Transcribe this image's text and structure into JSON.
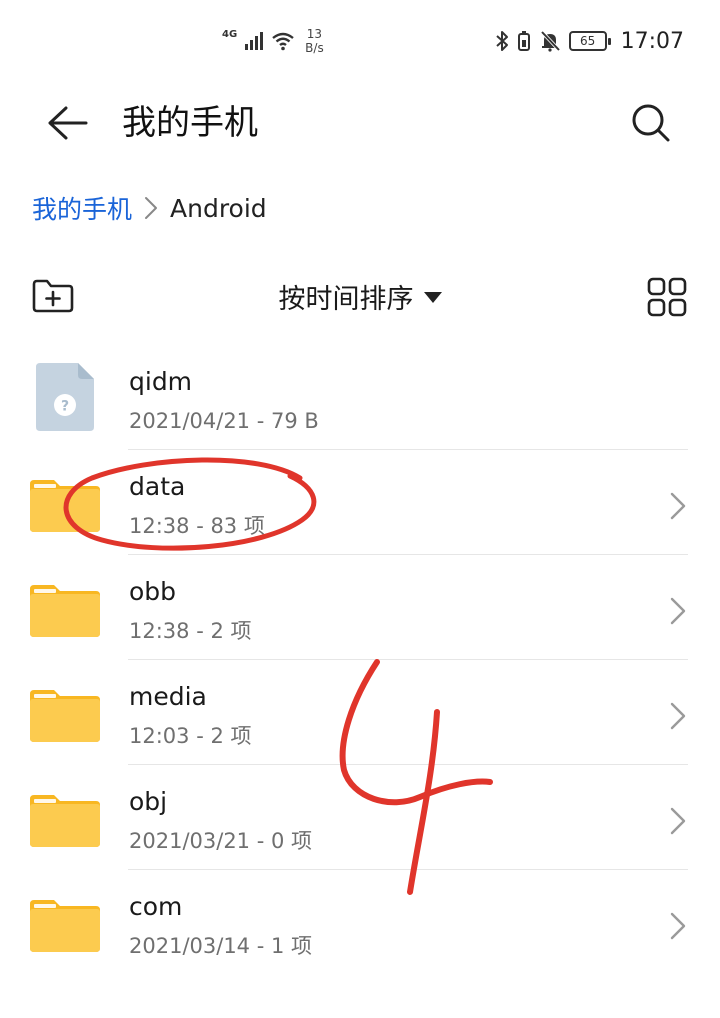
{
  "status_bar": {
    "network_type": "4G",
    "net_speed_value": "13",
    "net_speed_unit": "B/s",
    "battery_level": "65",
    "time": "17:07"
  },
  "header": {
    "title": "我的手机",
    "back_icon": "arrow-left-icon",
    "search_icon": "search-icon"
  },
  "breadcrumb": {
    "root": "我的手机",
    "current": "Android"
  },
  "toolbar": {
    "sort_label": "按时间排序",
    "new_folder_icon": "new-folder-icon",
    "grid_icon": "grid-view-icon"
  },
  "files": [
    {
      "name": "qidm",
      "meta": "2021/04/21 - 79 B",
      "type": "unknown-file"
    },
    {
      "name": "data",
      "meta": "12:38 - 83 项",
      "type": "folder"
    },
    {
      "name": "obb",
      "meta": "12:38 - 2 项",
      "type": "folder"
    },
    {
      "name": "media",
      "meta": "12:03 - 2 项",
      "type": "folder"
    },
    {
      "name": "obj",
      "meta": "2021/03/21 - 0 项",
      "type": "folder"
    },
    {
      "name": "com",
      "meta": "2021/03/14 - 1 项",
      "type": "folder"
    }
  ],
  "colors": {
    "accent": "#1a64d8",
    "folder": "#fcc33c",
    "annotation": "#e0352b"
  }
}
